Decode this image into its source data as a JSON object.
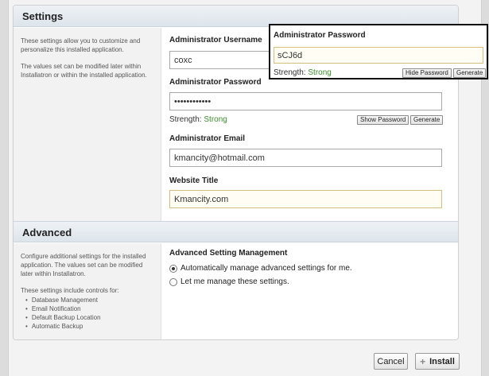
{
  "settings": {
    "header": "Settings",
    "desc_1": "These settings allow you to customize and personalize this installed application.",
    "desc_2": "The values set can be modified later within Installatron or within the installed application.",
    "admin_username_label": "Administrator Username",
    "admin_username_value": "coxc",
    "admin_password_label": "Administrator Password",
    "admin_password_value": "••••••••••••",
    "strength_label": "Strength:",
    "strength_value": "Strong",
    "show_password_label": "Show Password",
    "generate_label": "Generate",
    "admin_email_label": "Administrator Email",
    "admin_email_value": "kmancity@hotmail.com",
    "website_title_label": "Website Title",
    "website_title_value": "Kmancity.com"
  },
  "popup": {
    "title": "Administrator Password",
    "password_value": "sCJ6d",
    "strength_label": "Strength:",
    "strength_value": "Strong",
    "hide_password_label": "Hide Password",
    "generate_label": "Generate"
  },
  "advanced": {
    "header": "Advanced",
    "desc_1": "Configure additional settings for the installed application. The values set can be modified later within Installatron.",
    "desc_2": "These settings include controls for:",
    "controls": [
      "Database Management",
      "Email Notification",
      "Default Backup Location",
      "Automatic Backup"
    ],
    "management_label": "Advanced Setting Management",
    "option_auto": "Automatically manage advanced settings for me.",
    "option_manual": "Let me manage these settings."
  },
  "footer": {
    "cancel_label": "Cancel",
    "install_label": "Install",
    "install_icon": "plus-icon"
  }
}
